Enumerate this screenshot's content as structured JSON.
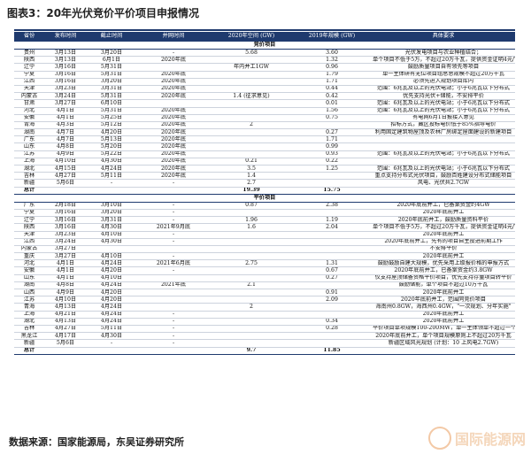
{
  "figure": {
    "title": "图表3：20年光伏竞价平价项目申报情况",
    "source": "数据来源：国家能源局，东吴证券研究所"
  },
  "table": {
    "columns": [
      "省份",
      "发布时间",
      "截止时间",
      "并网时间",
      "2020年空间 (GW)",
      "2019年规模 (GW)",
      "具体要求"
    ],
    "sections": [
      {
        "label": "竞价项目",
        "rows": [
          [
            "贵州",
            "3月13日",
            "3月20日",
            "-",
            "5.68",
            "3.60",
            "光伏发电项目与农业种植结合；"
          ],
          [
            "陕西",
            "3月13日",
            "6月1日",
            "2020年底",
            "",
            "1.32",
            "单个项目不低于5万，不超过20万千瓦，提供资金证明4元/W"
          ],
          [
            "辽宁",
            "3月16日",
            "5月31日",
            "",
            "年内并工1GW",
            "0.96",
            "鼓励质量项目自有领先等项目"
          ],
          [
            "宁夏",
            "3月16日",
            "5月31日",
            "2020年底",
            "",
            "1.79",
            "单一主体研有无位项目组总总规模不超过20万千瓦"
          ],
          [
            "江西",
            "3月16日",
            "3月20日",
            "2020年底",
            "",
            "1.71",
            "必须先进入规划项目库内"
          ],
          [
            "天津",
            "3月23日",
            "3月31日",
            "2020年底",
            "",
            "0.44",
            "范围：6兆瓦及以上的光伏电站；小于6兆瓦以下分布式"
          ],
          [
            "内蒙古",
            "3月24日",
            "5月31日",
            "2020年底",
            "1.4 (征求意见)",
            "0.42",
            "优先支持光伏+储能，不安排平价"
          ],
          [
            "甘肃",
            "3月27日",
            "6月10日",
            "",
            "",
            "0.01",
            "范围：6兆瓦及以上的光伏电站；小于6兆瓦以下分布式"
          ],
          [
            "河北",
            "4月1日",
            "5月31日",
            "2020年底",
            "",
            "1.56",
            "范围：6兆瓦及以上的光伏电站；小于6兆瓦以下分布式"
          ],
          [
            "安徽",
            "4月1日",
            "5月25日",
            "2020年底",
            "",
            "0.75",
            "有电网6月1日报接入意见"
          ],
          [
            "青海",
            "4月3日",
            "5月12日",
            "2020年底",
            "2",
            "",
            "招标方式，藏区投标电价低于85%指导电价"
          ],
          [
            "湖南",
            "4月7日",
            "4月20日",
            "2020年底",
            "",
            "0.27",
            "利用固定建筑物屋顶及农林厂房绑定屋面建设的新建项目"
          ],
          [
            "广东",
            "4月7日",
            "5月13日",
            "2020年底",
            "",
            "1.71",
            ""
          ],
          [
            "山东",
            "4月8日",
            "5月20日",
            "2020年底",
            "",
            "0.99",
            ""
          ],
          [
            "江苏",
            "4月9日",
            "5月22日",
            "2020年底",
            "",
            "0.93",
            "范围：6兆瓦及以上的光伏电站；小于6兆瓦以下分布式"
          ],
          [
            "上海",
            "4月10日",
            "4月30日",
            "2020年底",
            "0.21",
            "0.22",
            ""
          ],
          [
            "湖北",
            "4月15日",
            "4月24日",
            "2020年底",
            "3.5",
            "1.25",
            "范围：6兆瓦及以上的光伏电站；小于6兆瓦以下分布式"
          ],
          [
            "吉林",
            "4月27日",
            "5月11日",
            "2020年底",
            "1.4",
            "",
            "重点支持分布式光伏项目，鼓励百姓建设分布式储能项目"
          ],
          [
            "新疆",
            "5月6日",
            "-",
            "-",
            "2.7",
            "",
            "风电、光伏共2.7GW"
          ]
        ],
        "total": [
          "总计",
          "",
          "",
          "",
          "19.39",
          "15.75",
          ""
        ]
      },
      {
        "label": "平价项目",
        "rows": [
          [
            "广东",
            "2月18日",
            "3月10日",
            "-",
            "0.87",
            "2.38",
            "2020年底前并工，已备案资金约4GW"
          ],
          [
            "宁夏",
            "3月16日",
            "3月20日",
            "-",
            "",
            "",
            "2020年底前并工"
          ],
          [
            "辽宁",
            "3月16日",
            "3月31日",
            "-",
            "1.96",
            "1.19",
            "2020年底前并工，鼓励质量资料平价"
          ],
          [
            "陕西",
            "3月16日",
            "4月30日",
            "2021年9月底",
            "1.6",
            "2.04",
            "单个项目不低于5万，不超过20万千瓦，提供资金证明4元/W"
          ],
          [
            "天津",
            "3月23日",
            "4月10日",
            "-",
            "",
            "",
            "2020年底前并工"
          ],
          [
            "江西",
            "3月24日",
            "4月30日",
            "-",
            "",
            "",
            "2020年底前并工，先有的项目自主投进前期工作"
          ],
          [
            "内蒙古",
            "3月27日",
            "",
            "",
            "",
            "",
            "不安排平价"
          ],
          [
            "重庆",
            "3月27日",
            "4月10日",
            "-",
            "",
            "",
            "2020年底前并工"
          ],
          [
            "河北",
            "4月1日",
            "4月24日",
            "2021年6月底",
            "2.75",
            "1.31",
            "鼓励鼓励自建大规模，优先采用上级报价格的申报方式"
          ],
          [
            "安徽",
            "4月1日",
            "4月20日",
            "-",
            "",
            "0.67",
            "2020年底前并工，已备案资金约3.8GW"
          ],
          [
            "山东",
            "4月1日",
            "4月10日",
            "",
            "",
            "0.27",
            "仅支持屋顶储备资格平价项目，优先支持存量项目转平价"
          ],
          [
            "湖南",
            "4月8日",
            "4月24日",
            "2021年底",
            "2.1",
            "",
            "鼓励储能，单个项目不超过10万千瓦"
          ],
          [
            "山西",
            "4月9日",
            "4月20日",
            "",
            "",
            "0.91",
            "2020年底前并工"
          ],
          [
            "江苏",
            "4月10日",
            "4月20日",
            "",
            "",
            "2.09",
            "2020年底前并工，范围同竞价项目"
          ],
          [
            "青海",
            "4月13日",
            "4月24日",
            "",
            "2",
            "",
            "海南州0.8GW，海西州0.4GW，\"一次规划、分年实施\""
          ],
          [
            "上海",
            "4月21日",
            "4月24日",
            "-",
            "",
            "",
            "2020年底前并工"
          ],
          [
            "湖北",
            "4月13日",
            "4月24日",
            "-",
            "",
            "0.34",
            "2020年底前并工"
          ],
          [
            "吉林",
            "4月27日",
            "5月11日",
            "-",
            "",
            "0.28",
            "平价项目单项规模100-200MW，单一主体领单不超过一个项目"
          ],
          [
            "黑龙江",
            "4月17日",
            "4月30日",
            "-",
            "",
            "",
            "2020年底前并工，单个项目规模原则上不超过20万千瓦"
          ],
          [
            "新疆",
            "5月6日",
            "-",
            "-",
            "",
            "",
            "新疆区域风光规划 (计划：10 上风电2.7GW)"
          ]
        ],
        "total": [
          "总计",
          "",
          "",
          "",
          "9.7",
          "11.85",
          ""
        ]
      }
    ]
  },
  "watermark": {
    "text": "国际能源网",
    "logo_icon": "globe-logo-icon",
    "color": "#f3cfae"
  },
  "colors": {
    "header_bg": "#1f3a6e",
    "header_text": "#ffffff"
  }
}
